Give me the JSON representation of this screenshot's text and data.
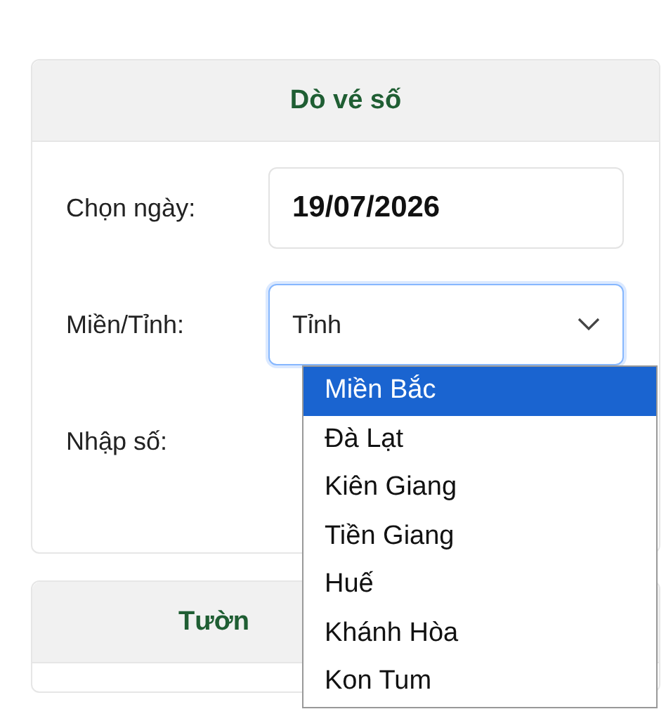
{
  "card": {
    "title": "Dò vé số",
    "fields": [
      {
        "kind": "date",
        "label": "Chọn ngày:",
        "value": "19/07/2026"
      },
      {
        "kind": "select",
        "label": "Miền/Tỉnh:",
        "value": "Tỉnh",
        "expanded": true
      },
      {
        "kind": "blank",
        "label": "Nhập số:"
      }
    ]
  },
  "dropdown": [
    {
      "label": "Miền Bắc",
      "selected": true
    },
    {
      "label": "Đà Lạt",
      "selected": false
    },
    {
      "label": "Kiên Giang",
      "selected": false
    },
    {
      "label": "Tiền Giang",
      "selected": false
    },
    {
      "label": "Huế",
      "selected": false
    },
    {
      "label": "Khánh Hòa",
      "selected": false
    },
    {
      "label": "Kon Tum",
      "selected": false
    }
  ],
  "second_card": {
    "title": "Tườn"
  }
}
